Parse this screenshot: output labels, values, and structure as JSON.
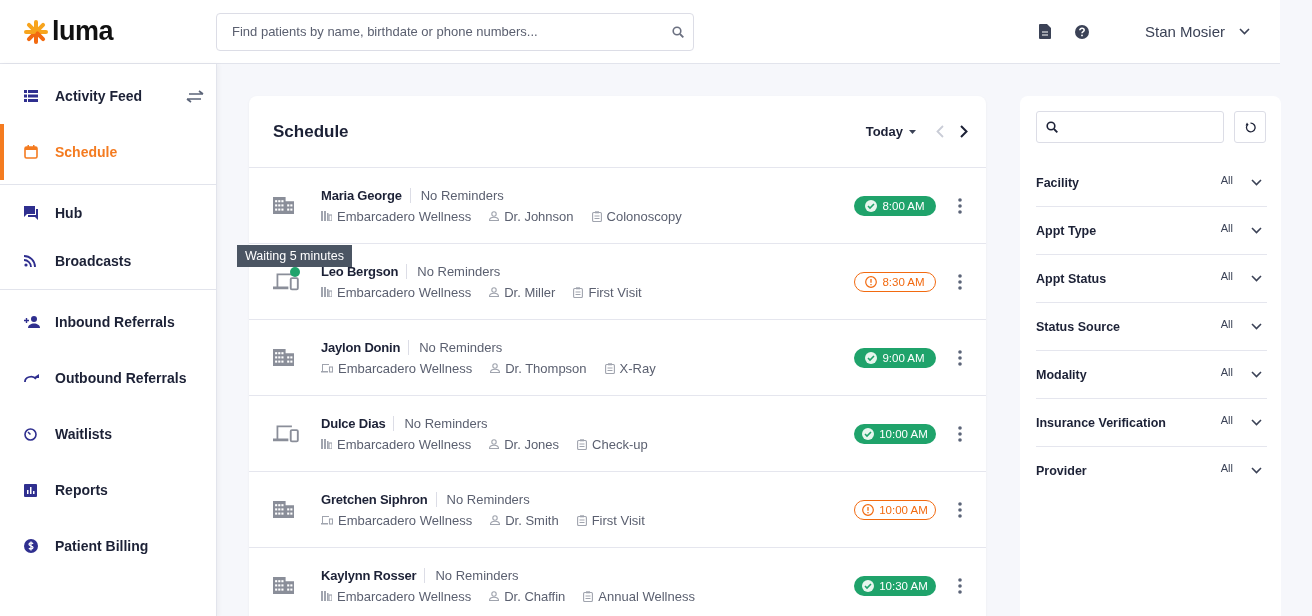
{
  "header": {
    "logo": "luma",
    "search": {
      "placeholder": "Find patients by name, birthdate or phone numbers..."
    },
    "user": "Stan Mosier"
  },
  "sidebar": {
    "groups": [
      {
        "items": [
          {
            "label": "Activity Feed",
            "selected": false,
            "swap": true
          },
          {
            "label": "Schedule",
            "selected": true
          }
        ]
      },
      {
        "items": [
          {
            "label": "Hub",
            "selected": false
          },
          {
            "label": "Broadcasts",
            "selected": false
          }
        ]
      },
      {
        "items": [
          {
            "label": "Inbound Referrals",
            "selected": false
          },
          {
            "label": "Outbound Referrals",
            "selected": false
          },
          {
            "label": "Waitlists",
            "selected": false
          },
          {
            "label": "Reports",
            "selected": false
          },
          {
            "label": "Patient Billing",
            "selected": false
          }
        ]
      }
    ]
  },
  "schedule": {
    "title": "Schedule",
    "date_filter": "Today",
    "rows": [
      {
        "patient": "Maria George",
        "reminders": "No Reminders",
        "virtual": false,
        "online": false,
        "facility_virtual": false,
        "facility": "Embarcadero Wellness",
        "provider": "Dr. Johnson",
        "appt_type": "Colonoscopy",
        "time": "8:00 AM",
        "confirmed": true
      },
      {
        "patient": "Leo Bergson",
        "reminders": "No Reminders",
        "virtual": true,
        "online": true,
        "tooltip": "Waiting 5 minutes",
        "facility_virtual": false,
        "facility": "Embarcadero Wellness",
        "provider": "Dr. Miller",
        "appt_type": "First Visit",
        "time": "8:30 AM",
        "confirmed": false
      },
      {
        "patient": "Jaylon Donin",
        "reminders": "No Reminders",
        "virtual": false,
        "online": false,
        "facility_virtual": true,
        "facility": "Embarcadero Wellness",
        "provider": "Dr. Thompson",
        "appt_type": "X-Ray",
        "time": "9:00 AM",
        "confirmed": true
      },
      {
        "patient": "Dulce Dias",
        "reminders": "No Reminders",
        "virtual": true,
        "online": false,
        "facility_virtual": false,
        "facility": "Embarcadero Wellness",
        "provider": "Dr. Jones",
        "appt_type": "Check-up",
        "time": "10:00 AM",
        "confirmed": true
      },
      {
        "patient": "Gretchen Siphron",
        "reminders": "No Reminders",
        "virtual": false,
        "online": false,
        "facility_virtual": true,
        "facility": "Embarcadero Wellness",
        "provider": "Dr. Smith",
        "appt_type": "First Visit",
        "time": "10:00 AM",
        "confirmed": false
      },
      {
        "patient": "Kaylynn Rosser",
        "reminders": "No Reminders",
        "virtual": false,
        "online": false,
        "facility_virtual": false,
        "facility": "Embarcadero Wellness",
        "provider": "Dr. Chaffin",
        "appt_type": "Annual Wellness",
        "time": "10:30 AM",
        "confirmed": true
      }
    ]
  },
  "filters": {
    "items": [
      {
        "label": "Facility",
        "value": "All"
      },
      {
        "label": "Appt Type",
        "value": "All"
      },
      {
        "label": "Appt Status",
        "value": "All"
      },
      {
        "label": "Status Source",
        "value": "All"
      },
      {
        "label": "Modality",
        "value": "All"
      },
      {
        "label": "Insurance Verification",
        "value": "All"
      },
      {
        "label": "Provider",
        "value": "All"
      }
    ]
  }
}
